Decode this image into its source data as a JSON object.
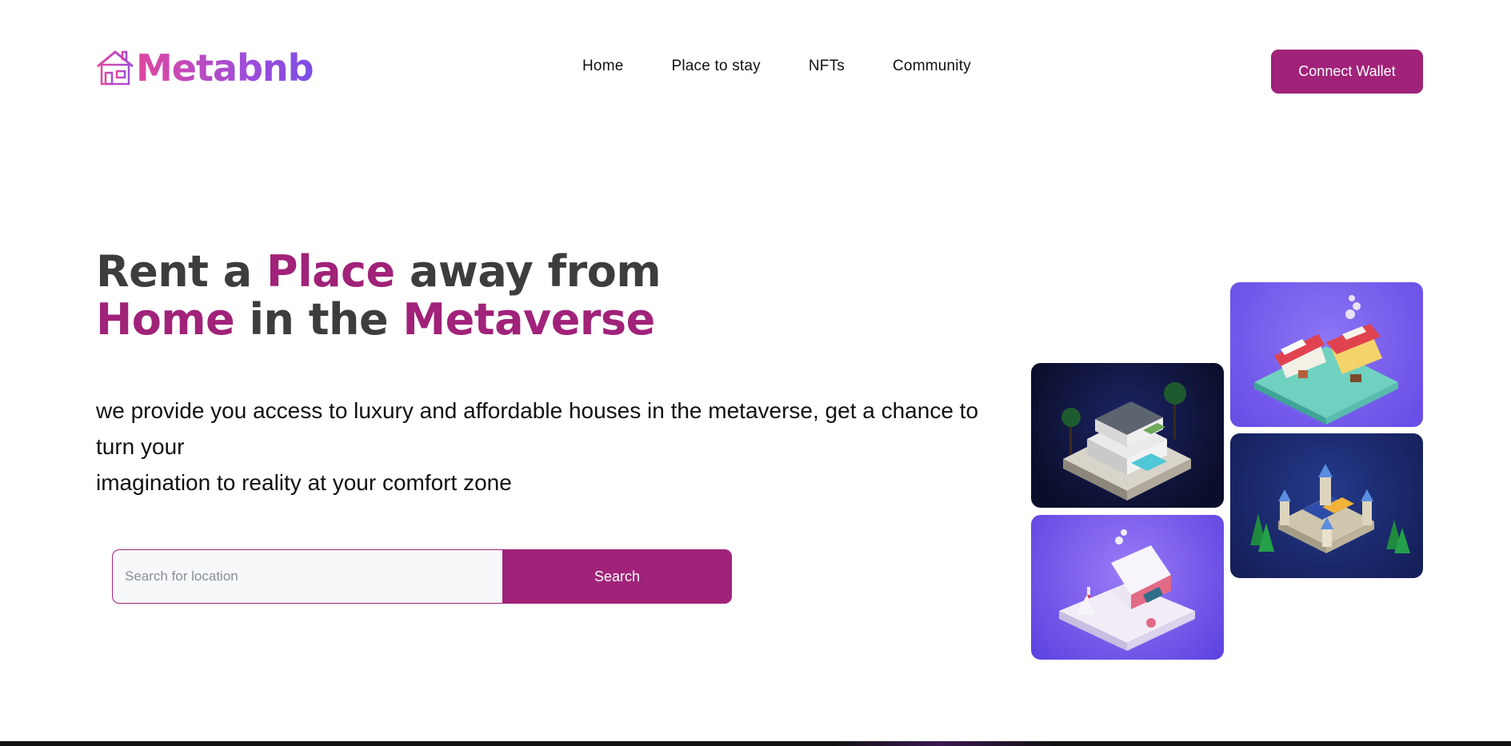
{
  "brand": {
    "name": "Metabnb",
    "icon": "house-icon"
  },
  "nav": {
    "items": [
      {
        "label": "Home"
      },
      {
        "label": "Place to stay"
      },
      {
        "label": "NFTs"
      },
      {
        "label": "Community"
      }
    ]
  },
  "header": {
    "connect_label": "Connect Wallet"
  },
  "hero": {
    "title_line1": {
      "a": "Rent a ",
      "b": "Place",
      "c": " away from"
    },
    "title_line2": {
      "a": "Home",
      "b": " in the ",
      "c": "Metaverse"
    },
    "desc_line1": "we provide you access to luxury and affordable houses in the metaverse, get a chance to turn your",
    "desc_line2": "imagination to reality at your comfort zone"
  },
  "search": {
    "placeholder": "Search for location",
    "button_label": "Search"
  },
  "gallery": {
    "items": [
      {
        "icon": "modern-villa-image"
      },
      {
        "icon": "market-stall-image"
      },
      {
        "icon": "castle-image"
      },
      {
        "icon": "snow-house-image"
      }
    ]
  },
  "colors": {
    "accent": "#a02279",
    "text_dark": "#3d3d3d",
    "logo_start": "#e0479f",
    "logo_end": "#7c4de6"
  }
}
